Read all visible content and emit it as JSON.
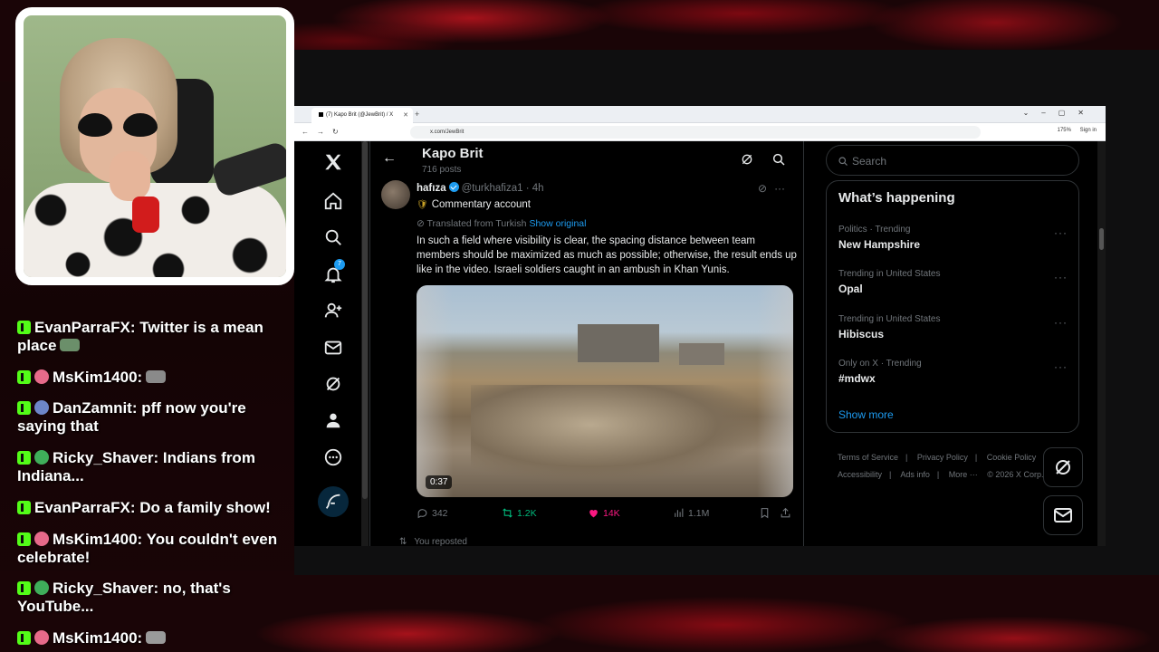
{
  "overlay": {
    "colors": {
      "accent_red": "#c0141f",
      "kick_green": "#53fc18"
    }
  },
  "chat": {
    "messages": [
      {
        "user": "EvanParraFX:",
        "text": "Twitter is a mean place",
        "emote": "frog-emote"
      },
      {
        "user": "MsKim1400:",
        "text": "",
        "emote": "cat-emote"
      },
      {
        "user": "DanZamnit:",
        "text": "pff now you're saying that",
        "emote": ""
      },
      {
        "user": "Ricky_Shaver:",
        "text": "Indians from Indiana...",
        "emote": ""
      },
      {
        "user": "EvanParraFX:",
        "text": "Do a family show!",
        "emote": ""
      },
      {
        "user": "MsKim1400:",
        "text": "You couldn't even celebrate!",
        "emote": ""
      },
      {
        "user": "Ricky_Shaver:",
        "text": "no, that's YouTube...",
        "emote": ""
      },
      {
        "user": "MsKim1400:",
        "text": "",
        "emote": "dog-emote"
      }
    ]
  },
  "browser": {
    "tab_title": "(7) Kapo Brit (@JewBrit) / X",
    "url": "x.com/JewBrit",
    "zoom": "175%",
    "signin": "Sign in"
  },
  "nav": {
    "notification_count": "7",
    "accent": "#1d9bf0"
  },
  "profile": {
    "name": "Kapo Brit",
    "posts": "716 posts"
  },
  "post": {
    "author": "hafıza",
    "handle": "@turkhafiza1 · 4h",
    "commentary": "Commentary account",
    "translated": "Translated from Turkish",
    "show_original": "Show original",
    "text": "In such a field where visibility is clear, the spacing distance between team members should be maximized as much as possible; otherwise, the result ends up like in the video. Israeli soldiers caught in an ambush in Khan Yunis.",
    "video_duration": "0:37",
    "replies": "342",
    "reposts": "1.2K",
    "likes": "14K",
    "views": "1.1M"
  },
  "next_item": {
    "reposted": "You reposted"
  },
  "sidebar": {
    "search_placeholder": "Search",
    "trends_title": "What’s happening",
    "trends": [
      {
        "context": "Politics · Trending",
        "name": "New Hampshire"
      },
      {
        "context": "Trending in United States",
        "name": "Opal"
      },
      {
        "context": "Trending in United States",
        "name": "Hibiscus"
      },
      {
        "context": "Only on X · Trending",
        "name": "#mdwx"
      }
    ],
    "show_more": "Show more",
    "footer": {
      "terms": "Terms of Service",
      "privacy": "Privacy Policy",
      "cookie": "Cookie Policy",
      "accessibility": "Accessibility",
      "ads": "Ads info",
      "more": "More ···",
      "copyright": "© 2026 X Corp."
    }
  }
}
